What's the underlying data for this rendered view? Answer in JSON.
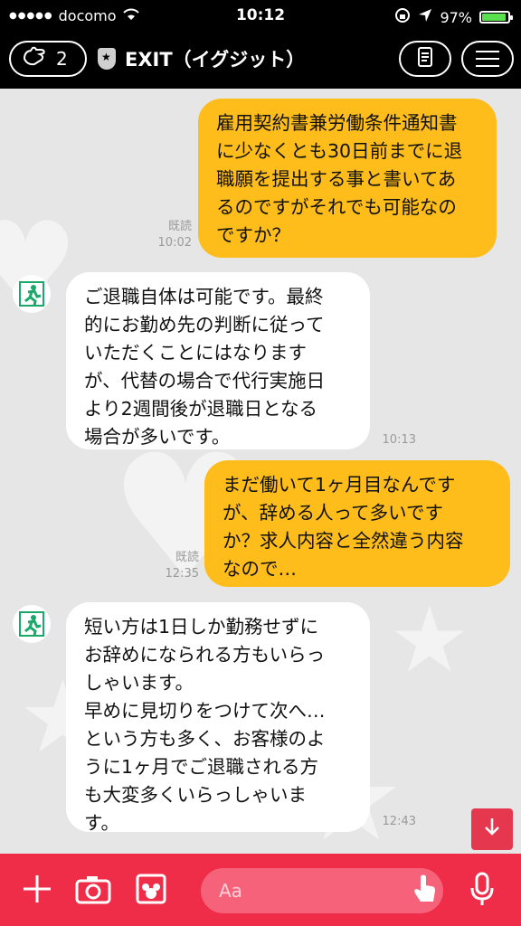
{
  "status_bar": {
    "carrier": "docomo",
    "time": "10:12",
    "battery": "97%"
  },
  "header": {
    "friend_count": "2",
    "title": "EXIT（イグジット）"
  },
  "messages": [
    {
      "side": "mine",
      "text": "雇用契約書兼労働条件通知書\nに少なくとも30日前までに退\n職願を提出する事と書いてあ\nるのですがそれでも可能なの\nですか？",
      "read": "既読",
      "time": "10:02"
    },
    {
      "side": "theirs",
      "text": "ご退職自体は可能です。最終\n的にお勤め先の判断に従って\nいただくことにはなります\nが、代替の場合で代行実施日\nより2週間後が退職日となる\n場合が多いです。",
      "time": "10:13"
    },
    {
      "side": "mine",
      "text": "まだ働いて1ヶ月目なんです\nが、辞める人って多いです\nか？求人内容と全然違う内容\nなので…",
      "read": "既読",
      "time": "12:35"
    },
    {
      "side": "theirs",
      "text": "短い方は1日しか勤務せずに\nお辞めになられる方もいらっ\nしゃいます。\n早めに見切りをつけて次へ…\nという方も多く、お客様のよ\nうに1ヶ月でご退職される方\nも大変多くいらっしゃいま\nす。",
      "time": "12:43"
    }
  ],
  "input": {
    "placeholder": "Aa"
  },
  "colors": {
    "mine_bubble": "#ffbd1c",
    "theirs_bubble": "#ffffff",
    "input_bar": "#ef2d48",
    "avatar_green": "#1aa86b"
  }
}
